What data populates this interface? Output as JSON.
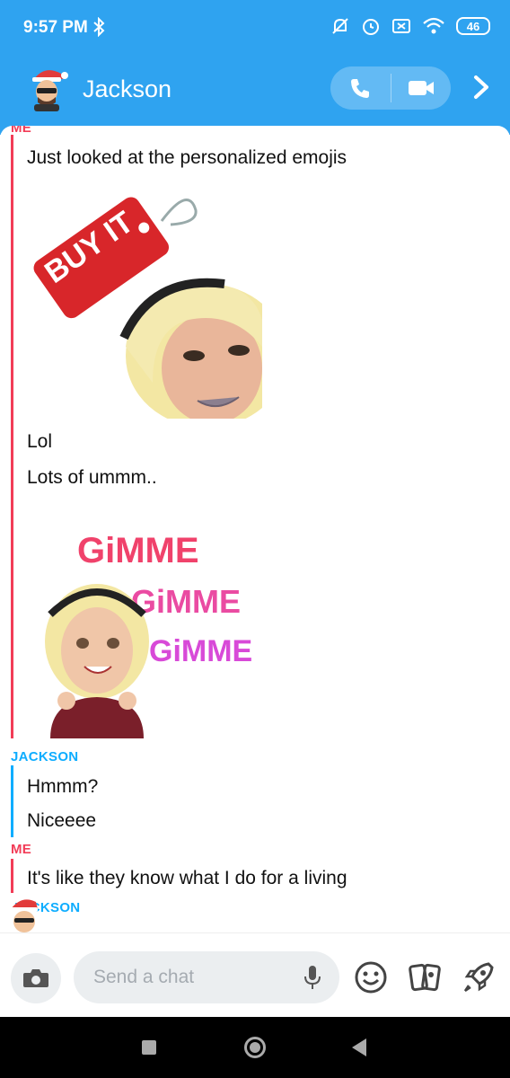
{
  "status_bar": {
    "time": "9:57 PM",
    "battery": "46",
    "icons": [
      "bluetooth-icon",
      "mute-icon",
      "alarm-icon",
      "sim-icon",
      "wifi-icon",
      "battery-icon"
    ]
  },
  "header": {
    "contact_name": "Jackson",
    "buttons": [
      "phone-call-icon",
      "video-call-icon",
      "chevron-right-icon"
    ]
  },
  "messages": {
    "sender_me_1": "ME",
    "me_1": "Just looked at the personalized emojis",
    "sticker_1_text": "BUY IT",
    "me_2": "Lol",
    "me_3": "Lots of ummm..",
    "sticker_2_text": "GiMME GiMME GiMME",
    "sender_jackson_1": "JACKSON",
    "jackson_1": "Hmmm?",
    "jackson_2": "Niceeee",
    "sender_me_2": "ME",
    "me_4": "It's like they know what I do for a living",
    "sender_jackson_2": "JACKSON"
  },
  "input_bar": {
    "placeholder": "Send a chat",
    "icons": [
      "camera-icon",
      "microphone-icon",
      "smiley-icon",
      "cards-icon",
      "rocket-icon"
    ]
  },
  "colors": {
    "header_blue": "#2fa3f0",
    "me_red": "#f23c57",
    "jackson_blue": "#0eadff"
  }
}
